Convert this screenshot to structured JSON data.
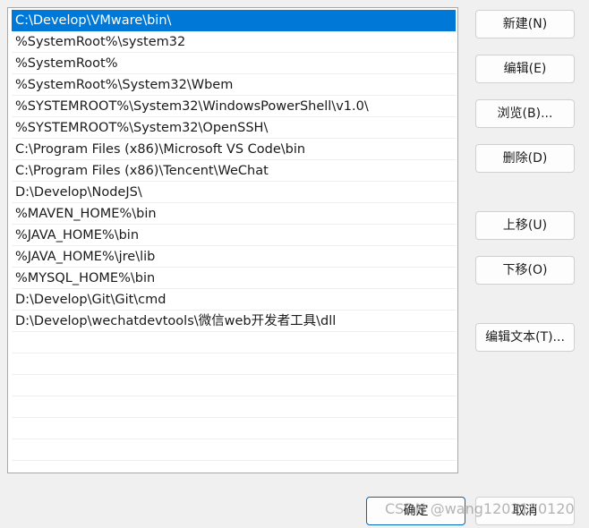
{
  "path_entries": [
    "C:\\Develop\\VMware\\bin\\",
    "%SystemRoot%\\system32",
    "%SystemRoot%",
    "%SystemRoot%\\System32\\Wbem",
    "%SYSTEMROOT%\\System32\\WindowsPowerShell\\v1.0\\",
    "%SYSTEMROOT%\\System32\\OpenSSH\\",
    "C:\\Program Files (x86)\\Microsoft VS Code\\bin",
    "C:\\Program Files (x86)\\Tencent\\WeChat",
    "D:\\Develop\\NodeJS\\",
    "%MAVEN_HOME%\\bin",
    "%JAVA_HOME%\\bin",
    "%JAVA_HOME%\\jre\\lib",
    "%MYSQL_HOME%\\bin",
    "D:\\Develop\\Git\\Git\\cmd",
    "D:\\Develop\\wechatdevtools\\微信web开发者工具\\dll"
  ],
  "selected_index": 0,
  "buttons": {
    "new": "新建(N)",
    "edit": "编辑(E)",
    "browse": "浏览(B)...",
    "delete": "删除(D)",
    "move_up": "上移(U)",
    "move_down": "下移(O)",
    "edit_text": "编辑文本(T)...",
    "ok": "确定",
    "cancel": "取消"
  },
  "watermark": "CSDN @wang1202120120",
  "colors": {
    "selection": "#0078d7",
    "primary_border": "#0067c0"
  }
}
